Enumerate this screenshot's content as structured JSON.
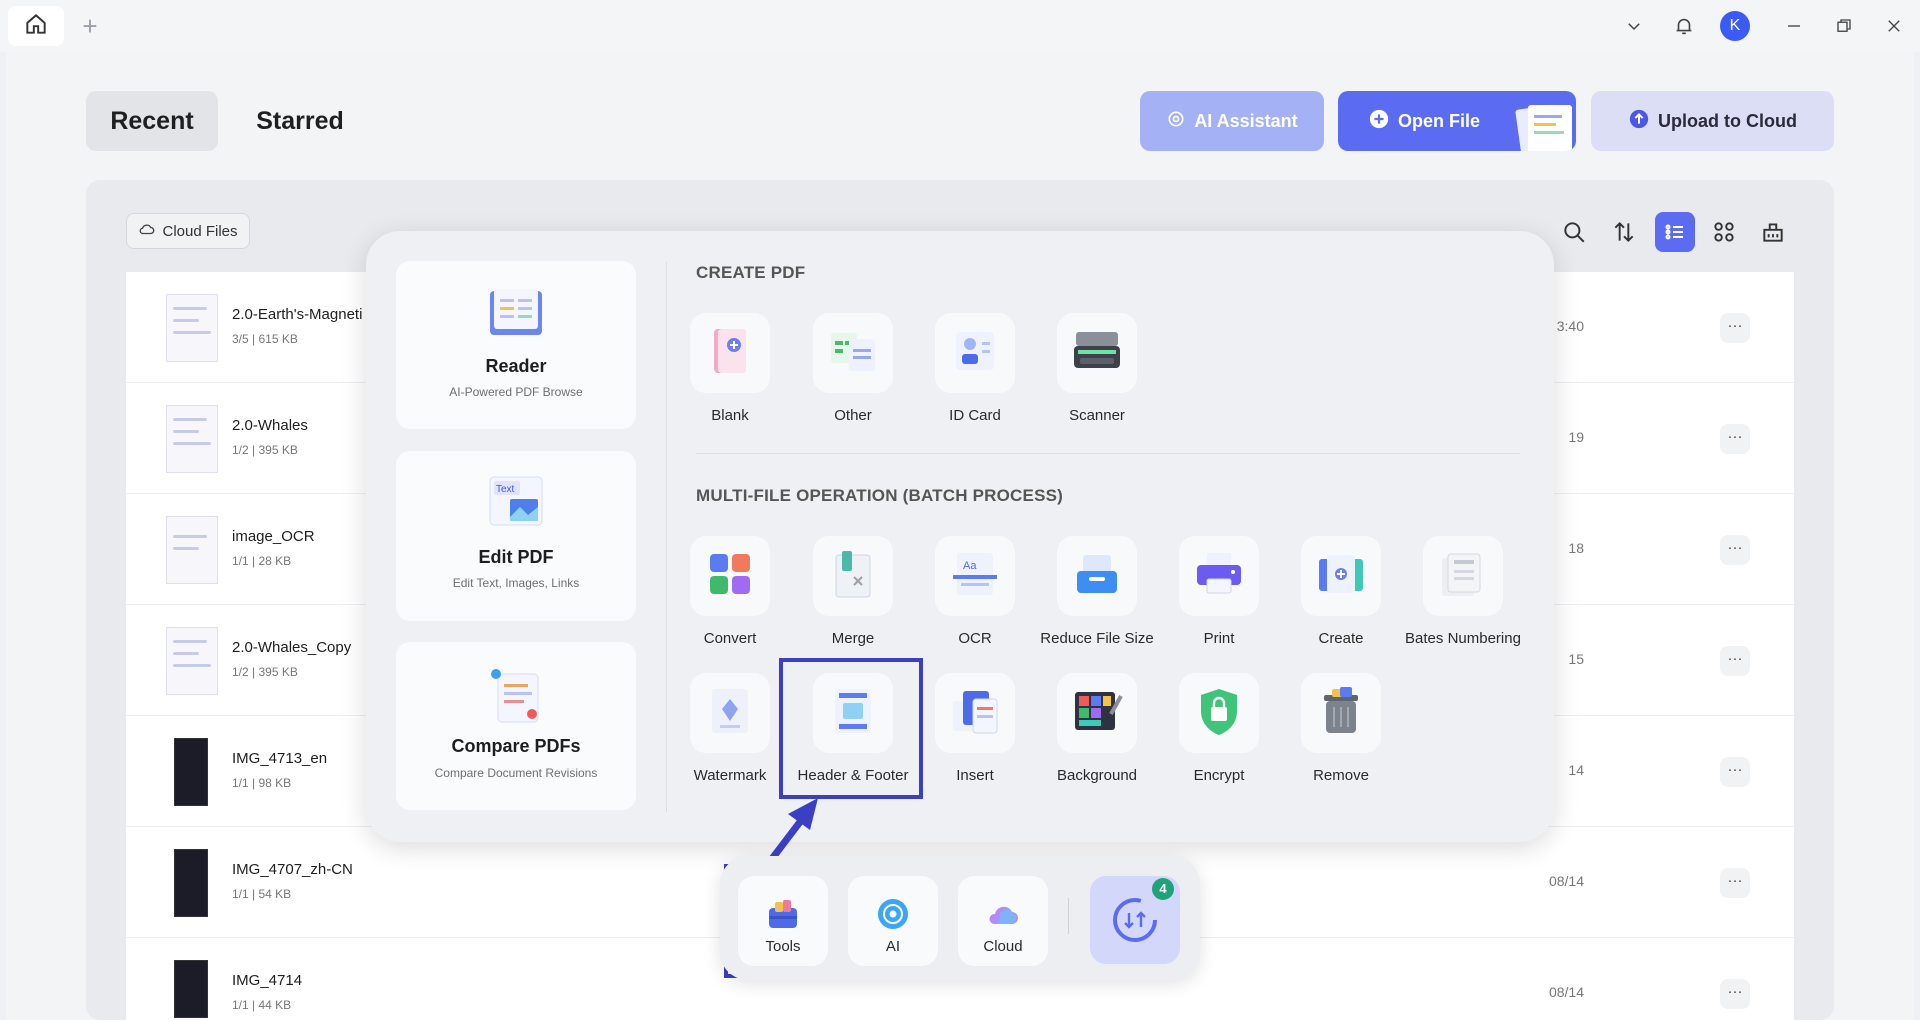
{
  "tabs": {
    "recent": "Recent",
    "starred": "Starred"
  },
  "header_buttons": {
    "ai_assistant": "AI Assistant",
    "open_file": "Open File",
    "upload_to_cloud": "Upload to Cloud"
  },
  "titlebar": {
    "avatar_letter": "K",
    "plus": "+"
  },
  "cloud_files": "Cloud Files",
  "files": [
    {
      "name": "2.0-Earth's-Magneti",
      "meta": "3/5 | 615 KB",
      "date": "3:40"
    },
    {
      "name": "2.0-Whales",
      "meta": "1/2 | 395 KB",
      "date": "19"
    },
    {
      "name": "image_OCR",
      "meta": "1/1 | 28 KB",
      "date": "18"
    },
    {
      "name": "2.0-Whales_Copy",
      "meta": "1/2 | 395 KB",
      "date": "15"
    },
    {
      "name": "IMG_4713_en",
      "meta": "1/1 | 98 KB",
      "date": "14"
    },
    {
      "name": "IMG_4707_zh-CN",
      "meta": "1/1 | 54 KB",
      "date": "08/14"
    },
    {
      "name": "IMG_4714",
      "meta": "1/1 | 44 KB",
      "date": "08/14"
    }
  ],
  "more_label": "···",
  "cards": [
    {
      "title": "Reader",
      "sub": "AI-Powered PDF Browse"
    },
    {
      "title": "Edit PDF",
      "sub": "Edit Text, Images, Links"
    },
    {
      "title": "Compare PDFs",
      "sub": "Compare Document Revisions"
    }
  ],
  "sections": {
    "create": "CREATE PDF",
    "multi": "MULTI-FILE OPERATION (BATCH PROCESS)"
  },
  "create_tools": [
    "Blank",
    "Other",
    "ID Card",
    "Scanner"
  ],
  "batch_tools_row1": [
    "Convert",
    "Merge",
    "OCR",
    "Reduce File Size",
    "Print",
    "Create",
    "Bates Numbering"
  ],
  "batch_tools_row2": [
    "Watermark",
    "Header & Footer",
    "Insert",
    "Background",
    "Encrypt",
    "Remove"
  ],
  "dock": {
    "tools": "Tools",
    "ai": "AI",
    "cloud": "Cloud",
    "sync_badge": "4"
  },
  "colors": {
    "accent": "#5b6cf3",
    "highlight": "#3b3fc4",
    "badge": "#1fa37a"
  }
}
